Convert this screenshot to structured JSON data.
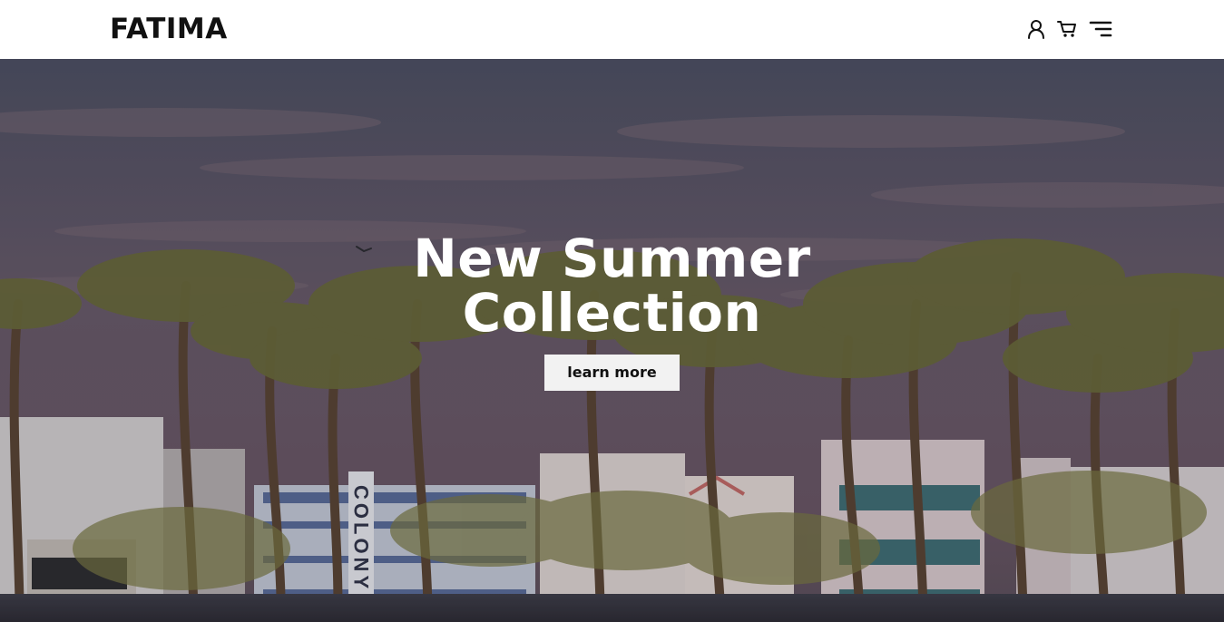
{
  "header": {
    "brand": "FATIMA",
    "icons": [
      "user-icon",
      "cart-icon",
      "menu-icon"
    ]
  },
  "hero": {
    "headline_line1": "New Summer",
    "headline_line2": "Collection",
    "cta_label": "learn more",
    "sign_text": "COLONY"
  },
  "colors": {
    "header_bg": "#ffffff",
    "brand_text": "#111111",
    "headline_text": "#ffffff",
    "cta_bg": "#f2f2f2",
    "overlay": "#1e1e28"
  }
}
